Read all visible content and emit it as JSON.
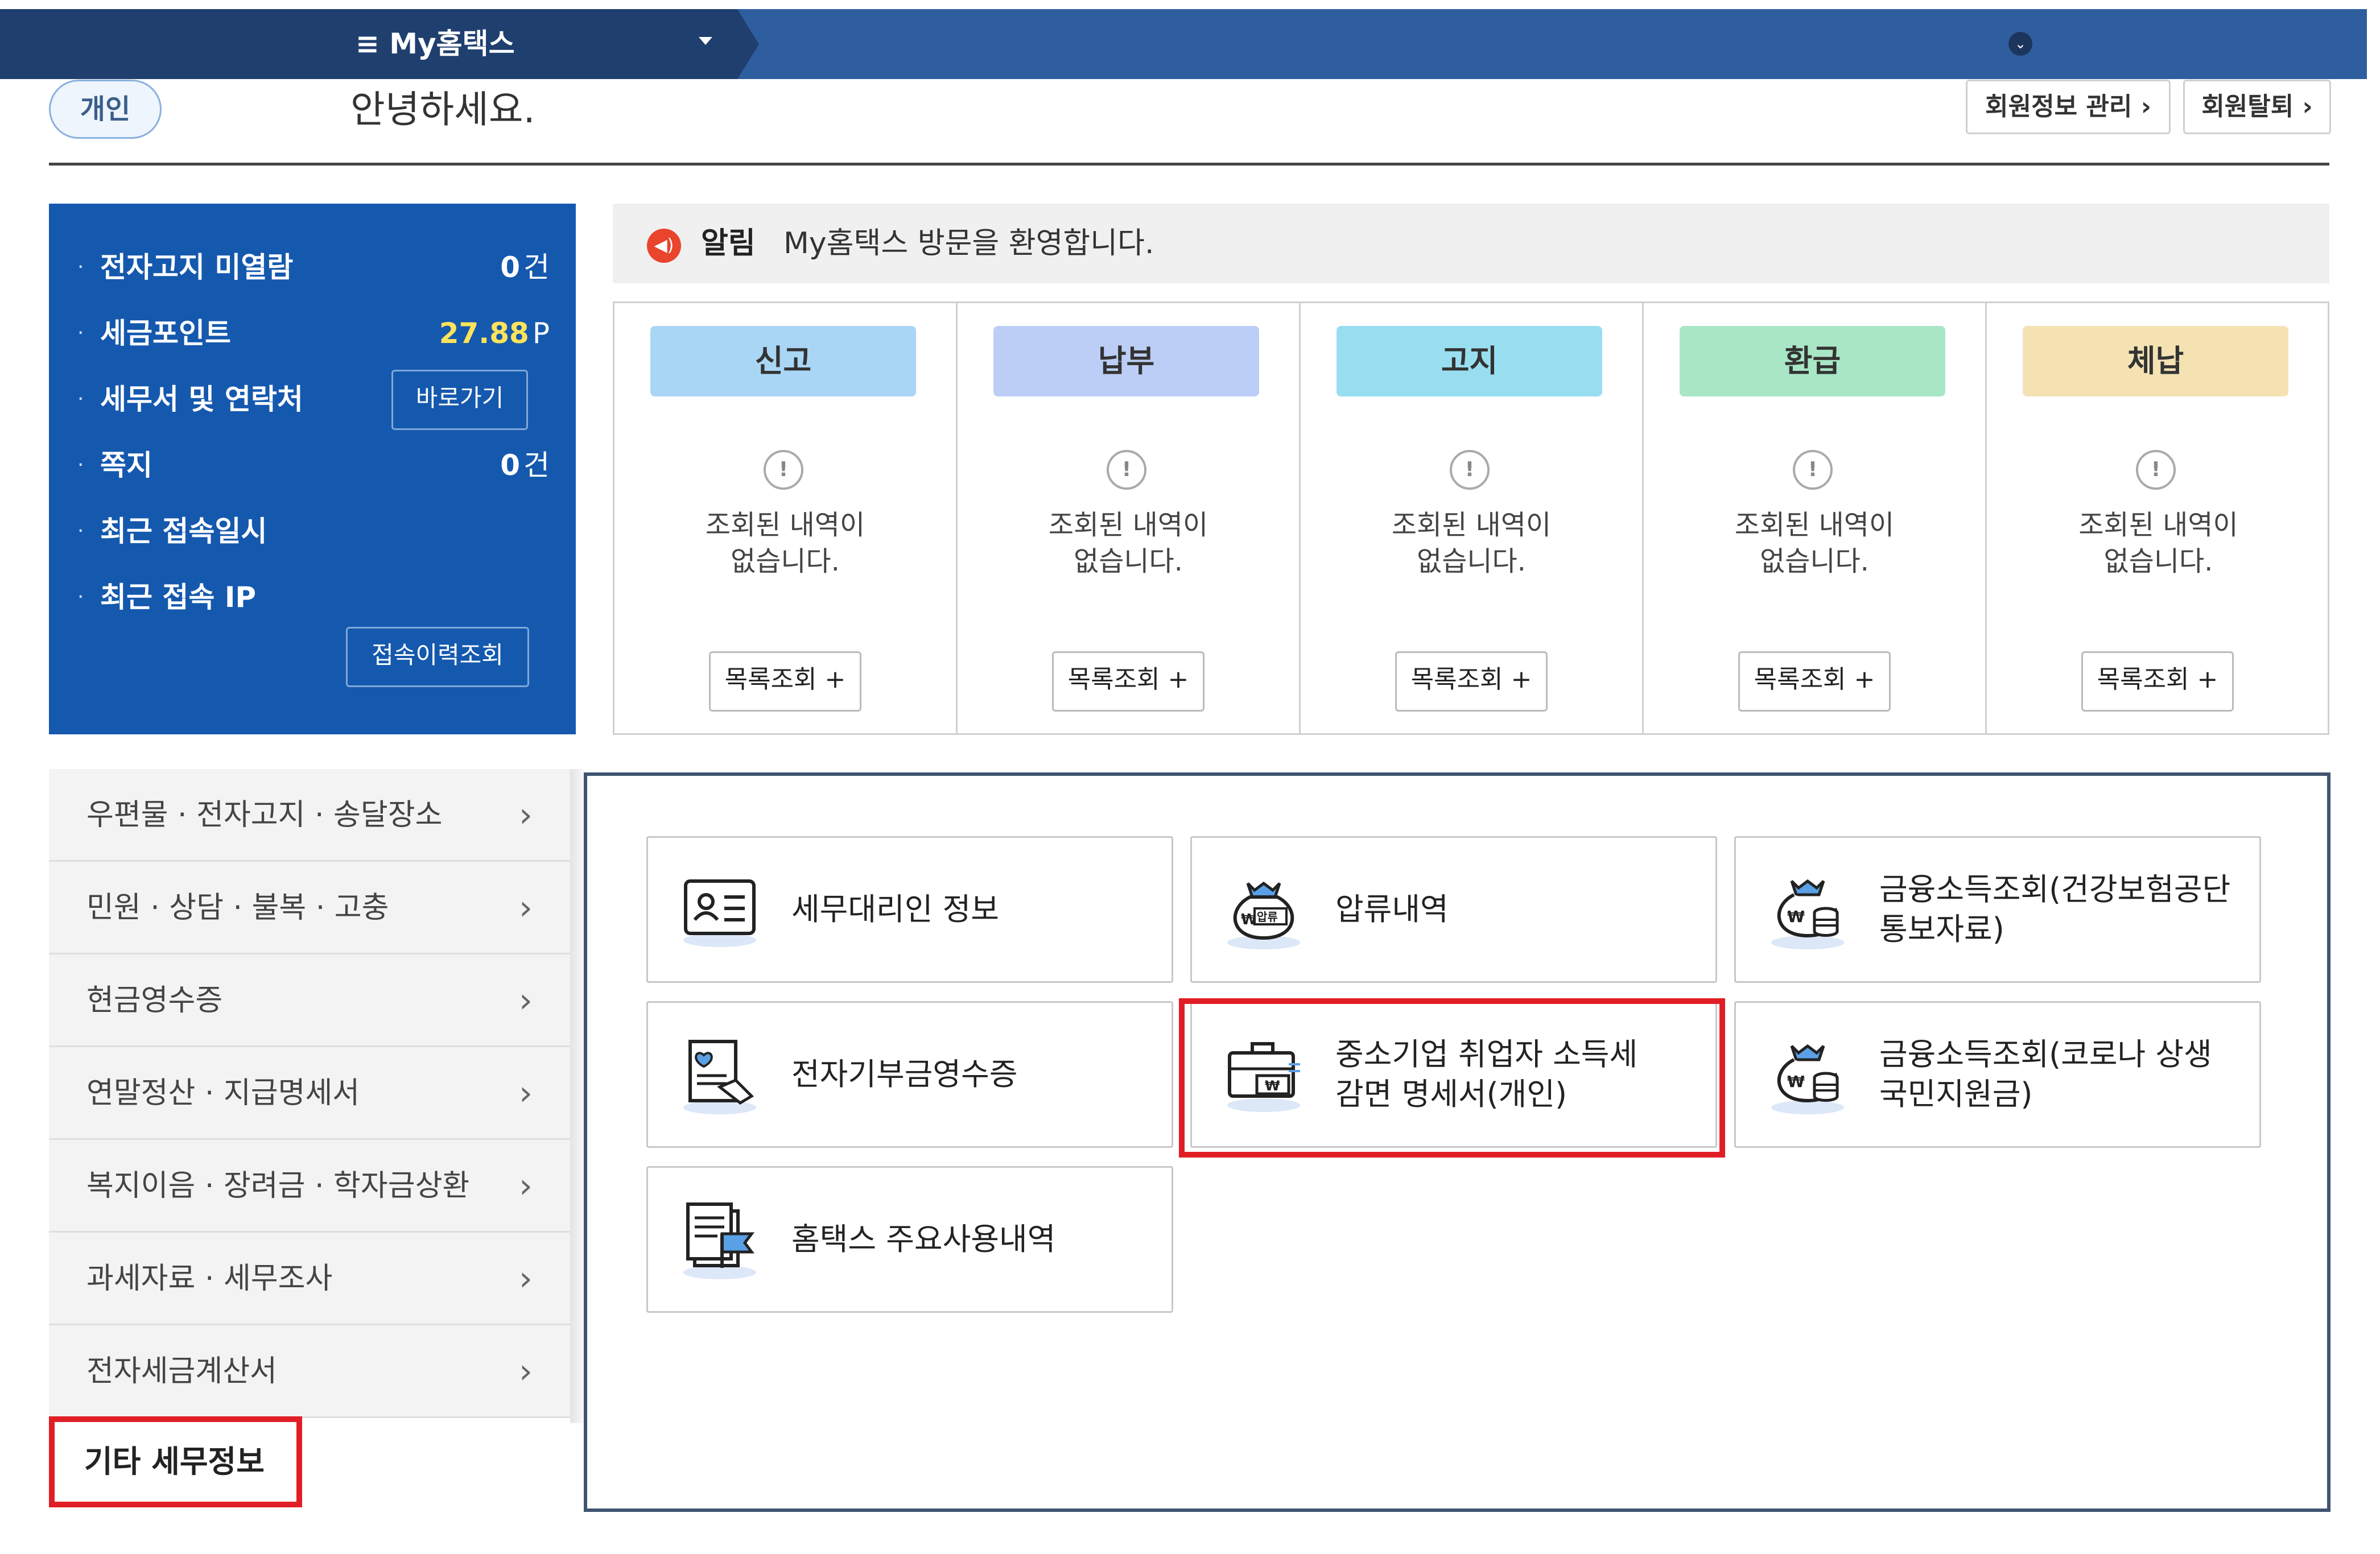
{
  "topnav": {
    "menu_label": "≡  My홈택스"
  },
  "greeting": {
    "badge": "개인",
    "text": "안녕하세요.",
    "buttons": [
      "회원정보 관리 ›",
      "회원탈퇴 ›"
    ]
  },
  "info_panel": {
    "rows": [
      {
        "label": "전자고지 미열람",
        "value": "0",
        "unit": "건"
      },
      {
        "label": "세금포인트",
        "value": "27.88",
        "unit": "P"
      },
      {
        "label": "세무서 및 연락처",
        "button": "바로가기"
      },
      {
        "label": "쪽지",
        "value": "0",
        "unit": "건"
      },
      {
        "label": "최근 접속일시"
      },
      {
        "label": "최근 접속 IP"
      }
    ],
    "history_button": "접속이력조회"
  },
  "notice": {
    "tag": "알림",
    "text": "My홈택스 방문을 환영합니다."
  },
  "categories": [
    {
      "title": "신고",
      "message": "조회된 내역이\n없습니다.",
      "button": "목록조회 +",
      "color": "#a9d6f5"
    },
    {
      "title": "납부",
      "message": "조회된 내역이\n없습니다.",
      "button": "목록조회 +",
      "color": "#bccdf6"
    },
    {
      "title": "고지",
      "message": "조회된 내역이\n없습니다.",
      "button": "목록조회 +",
      "color": "#99def0"
    },
    {
      "title": "환급",
      "message": "조회된 내역이\n없습니다.",
      "button": "목록조회 +",
      "color": "#a8e6c6"
    },
    {
      "title": "체납",
      "message": "조회된 내역이\n없습니다.",
      "button": "목록조회 +",
      "color": "#f4e2b3"
    }
  ],
  "left_menu": {
    "items": [
      "우편물 · 전자고지 · 송달장소",
      "민원 · 상담 · 불복 · 고충",
      "현금영수증",
      "연말정산 · 지급명세서",
      "복지이음 · 장려금 · 학자금상환",
      "과세자료 · 세무조사",
      "전자세금계산서"
    ],
    "active": "기타 세무정보"
  },
  "tiles": [
    {
      "label": "세무대리인 정보",
      "icon": "id-card-icon"
    },
    {
      "label": "압류내역",
      "icon": "seizure-money-bag-icon"
    },
    {
      "label": "금융소득조회(건강보험공단\n통보자료)",
      "icon": "money-bag-coins-icon"
    },
    {
      "label": "전자기부금영수증",
      "icon": "donation-receipt-icon"
    },
    {
      "label": "중소기업 취업자 소득세\n감면 명세서(개인)",
      "icon": "briefcase-won-icon"
    },
    {
      "label": "금융소득조회(코로나 상생\n국민지원금)",
      "icon": "money-bag-coins-icon"
    },
    {
      "label": "홈택스 주요사용내역",
      "icon": "document-flag-icon"
    }
  ],
  "colors": {
    "nav": "#2f5e9f",
    "nav_dark": "#1f3f6f",
    "info_panel": "#1559ae",
    "highlight": "#e11e25"
  }
}
